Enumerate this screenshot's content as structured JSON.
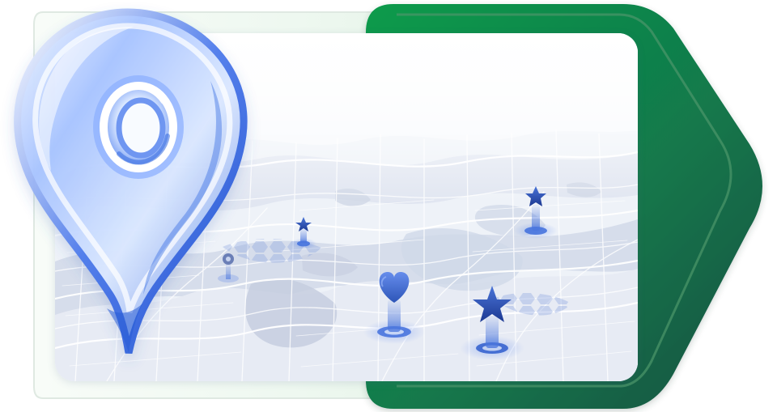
{
  "colors": {
    "frame_start": "#0e9f4a",
    "frame_end": "#15583f",
    "frame_inner": "#3b8b5b",
    "map_paper": "#f5f7fb",
    "map_land": "#dfe4ef",
    "map_water": "#ced6e7",
    "road": "#ffffff",
    "marker_blue": "#3f6fdc",
    "marker_navy": "#1f3f9d",
    "glass_blue": "#7ea3f0",
    "glass_highlight": "#eaf3ff"
  },
  "icons": {
    "location_pin": "location-pin-icon",
    "heart_marker": "heart-map-marker-icon",
    "star_marker": "star-map-marker-icon"
  },
  "visual": {
    "scene": "3d-location-pin-on-city-map"
  }
}
